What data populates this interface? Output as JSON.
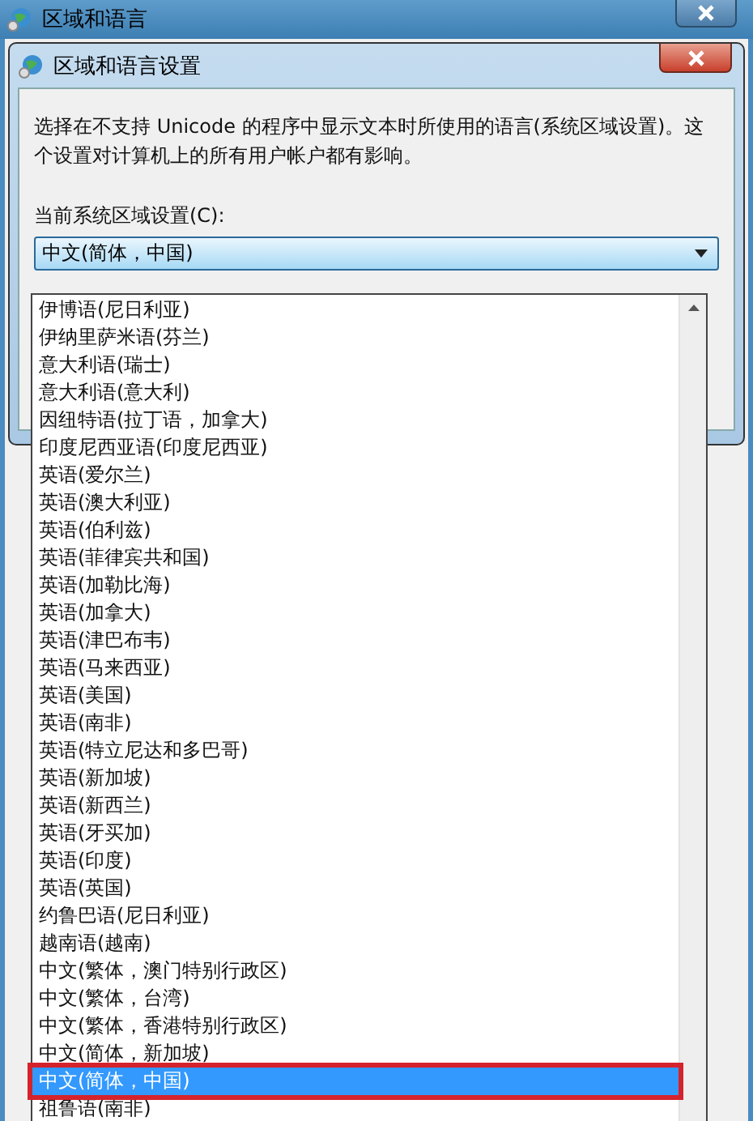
{
  "outer_window": {
    "title": "区域和语言"
  },
  "dialog": {
    "title": "区域和语言设置",
    "description": "选择在不支持 Unicode 的程序中显示文本时所使用的语言(系统区域设置)。这个设置对计算机上的所有用户帐户都有影响。",
    "locale_label": "当前系统区域设置(C):",
    "locale_select": {
      "value": "中文(简体，中国)",
      "expanded": true
    }
  },
  "dropdown_list": {
    "items": [
      {
        "label": "伊博语(尼日利亚)",
        "selected": false,
        "outlined": false
      },
      {
        "label": "伊纳里萨米语(芬兰)",
        "selected": false,
        "outlined": false
      },
      {
        "label": "意大利语(瑞士)",
        "selected": false,
        "outlined": false
      },
      {
        "label": "意大利语(意大利)",
        "selected": false,
        "outlined": false
      },
      {
        "label": "因纽特语(拉丁语，加拿大)",
        "selected": false,
        "outlined": false
      },
      {
        "label": "印度尼西亚语(印度尼西亚)",
        "selected": false,
        "outlined": false
      },
      {
        "label": "英语(爱尔兰)",
        "selected": false,
        "outlined": false
      },
      {
        "label": "英语(澳大利亚)",
        "selected": false,
        "outlined": false
      },
      {
        "label": "英语(伯利兹)",
        "selected": false,
        "outlined": false
      },
      {
        "label": "英语(菲律宾共和国)",
        "selected": false,
        "outlined": false
      },
      {
        "label": "英语(加勒比海)",
        "selected": false,
        "outlined": false
      },
      {
        "label": "英语(加拿大)",
        "selected": false,
        "outlined": false
      },
      {
        "label": "英语(津巴布韦)",
        "selected": false,
        "outlined": false
      },
      {
        "label": "英语(马来西亚)",
        "selected": false,
        "outlined": false
      },
      {
        "label": "英语(美国)",
        "selected": false,
        "outlined": false
      },
      {
        "label": "英语(南非)",
        "selected": false,
        "outlined": false
      },
      {
        "label": "英语(特立尼达和多巴哥)",
        "selected": false,
        "outlined": false
      },
      {
        "label": "英语(新加坡)",
        "selected": false,
        "outlined": false
      },
      {
        "label": "英语(新西兰)",
        "selected": false,
        "outlined": false
      },
      {
        "label": "英语(牙买加)",
        "selected": false,
        "outlined": false
      },
      {
        "label": "英语(印度)",
        "selected": false,
        "outlined": false
      },
      {
        "label": "英语(英国)",
        "selected": false,
        "outlined": false
      },
      {
        "label": "约鲁巴语(尼日利亚)",
        "selected": false,
        "outlined": false
      },
      {
        "label": "越南语(越南)",
        "selected": false,
        "outlined": false
      },
      {
        "label": "中文(繁体，澳门特别行政区)",
        "selected": false,
        "outlined": false
      },
      {
        "label": "中文(繁体，台湾)",
        "selected": false,
        "outlined": false
      },
      {
        "label": "中文(繁体，香港特别行政区)",
        "selected": false,
        "outlined": false
      },
      {
        "label": "中文(简体，新加坡)",
        "selected": false,
        "outlined": false
      },
      {
        "label": "中文(简体，中国)",
        "selected": true,
        "outlined": true
      },
      {
        "label": "祖鲁语(南非)",
        "selected": false,
        "outlined": false
      }
    ]
  }
}
